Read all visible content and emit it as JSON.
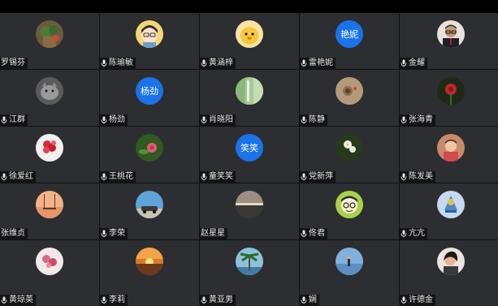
{
  "participants": [
    {
      "name": "罗锡芬",
      "mic": false,
      "avatar": "photo-plant"
    },
    {
      "name": "陈瑜敏",
      "mic": true,
      "avatar": "cartoon-girl"
    },
    {
      "name": "黄涵梓",
      "mic": true,
      "avatar": "cartoon-duck"
    },
    {
      "name": "雷艳妮",
      "mic": true,
      "avatar": "text",
      "avatar_text": "艳妮"
    },
    {
      "name": "金耀",
      "mic": true,
      "avatar": "photo-man"
    },
    {
      "name": "江群",
      "mic": true,
      "avatar": "photo-cat"
    },
    {
      "name": "杨劲",
      "mic": true,
      "avatar": "text",
      "avatar_text": "杨劲"
    },
    {
      "name": "肖晓阳",
      "mic": true,
      "avatar": "photo-green"
    },
    {
      "name": "陈静",
      "mic": true,
      "avatar": "photo-sand"
    },
    {
      "name": "张海青",
      "mic": true,
      "avatar": "photo-rose"
    },
    {
      "name": "徐爱红",
      "mic": true,
      "avatar": "photo-redflowers"
    },
    {
      "name": "王桃花",
      "mic": true,
      "avatar": "photo-pinkflower"
    },
    {
      "name": "童笑笑",
      "mic": true,
      "avatar": "text",
      "avatar_text": "笑笑"
    },
    {
      "name": "党新萍",
      "mic": true,
      "avatar": "photo-whiteflowers"
    },
    {
      "name": "陈发美",
      "mic": true,
      "avatar": "photo-child"
    },
    {
      "name": "张维贞",
      "mic": false,
      "avatar": "photo-swing"
    },
    {
      "name": "李荣",
      "mic": true,
      "avatar": "photo-car"
    },
    {
      "name": "赵星星",
      "mic": false,
      "avatar": "photo-sunset"
    },
    {
      "name": "佟君",
      "mic": true,
      "avatar": "cartoon-glasses"
    },
    {
      "name": "亢亢",
      "mic": true,
      "avatar": "photo-blue"
    },
    {
      "name": "黄琼英",
      "mic": true,
      "avatar": "photo-blossom"
    },
    {
      "name": "李莉",
      "mic": true,
      "avatar": "photo-sunrise"
    },
    {
      "name": "黄亚男",
      "mic": true,
      "avatar": "photo-palm"
    },
    {
      "name": "娴",
      "mic": true,
      "avatar": "photo-beach"
    },
    {
      "name": "许德金",
      "mic": true,
      "avatar": "photo-woman"
    }
  ],
  "colors": {
    "tile_bg": "#2d2e31",
    "text_avatar_bg": "#1a73e8",
    "name_text": "#e8e8e8"
  }
}
